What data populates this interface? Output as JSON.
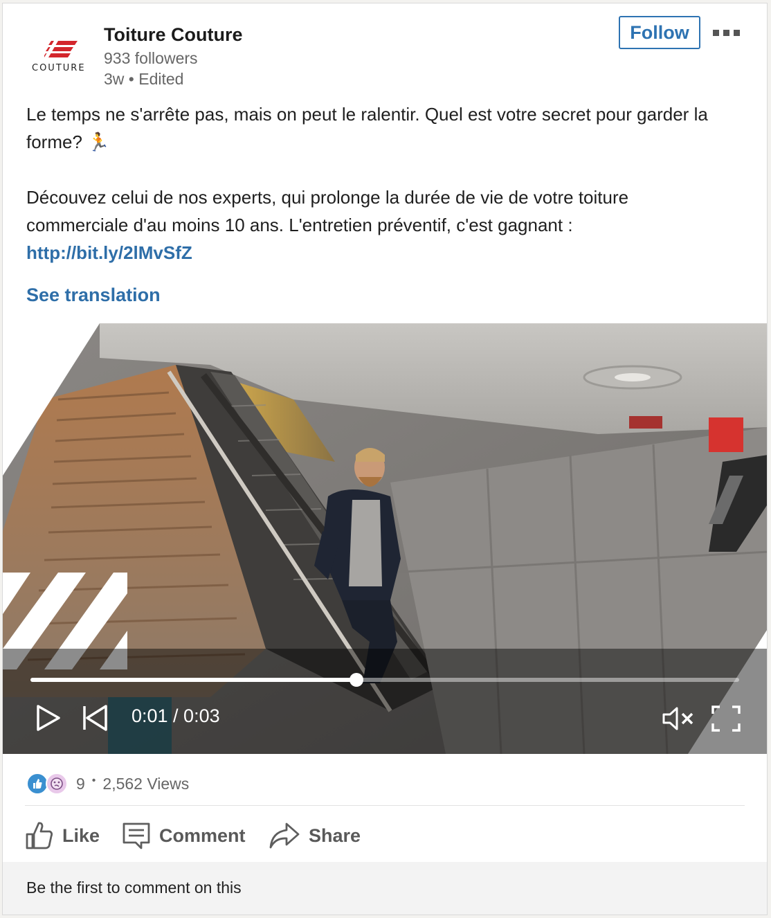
{
  "company": {
    "name": "Toiture Couture",
    "followers": "933 followers",
    "meta": "3w • Edited",
    "logo_text": "COUTURE"
  },
  "follow_label": "Follow",
  "post": {
    "line1": "Le temps ne s'arrête pas, mais on peut le ralentir. Quel est votre secret pour garder la forme? 🏃",
    "line2": "Découvez celui de nos experts, qui prolonge la durée de vie de votre toiture commerciale d'au moins 10 ans. L'entretien préventif, c'est gagnant :",
    "link": "http://bit.ly/2lMvSfZ"
  },
  "see_translation": "See translation",
  "video": {
    "current_time": "0:01",
    "duration": "0:03",
    "time_display": "0:01 / 0:03",
    "progress": 0.46
  },
  "social": {
    "reaction_count": "9",
    "separator": "•",
    "views": "2,562 Views"
  },
  "actions": {
    "like": "Like",
    "comment": "Comment",
    "share": "Share"
  },
  "comment_prompt": "Be the first to comment on this",
  "colors": {
    "link": "#2e6ea8",
    "follow": "#2e73b2",
    "brand_red": "#d3262c"
  }
}
